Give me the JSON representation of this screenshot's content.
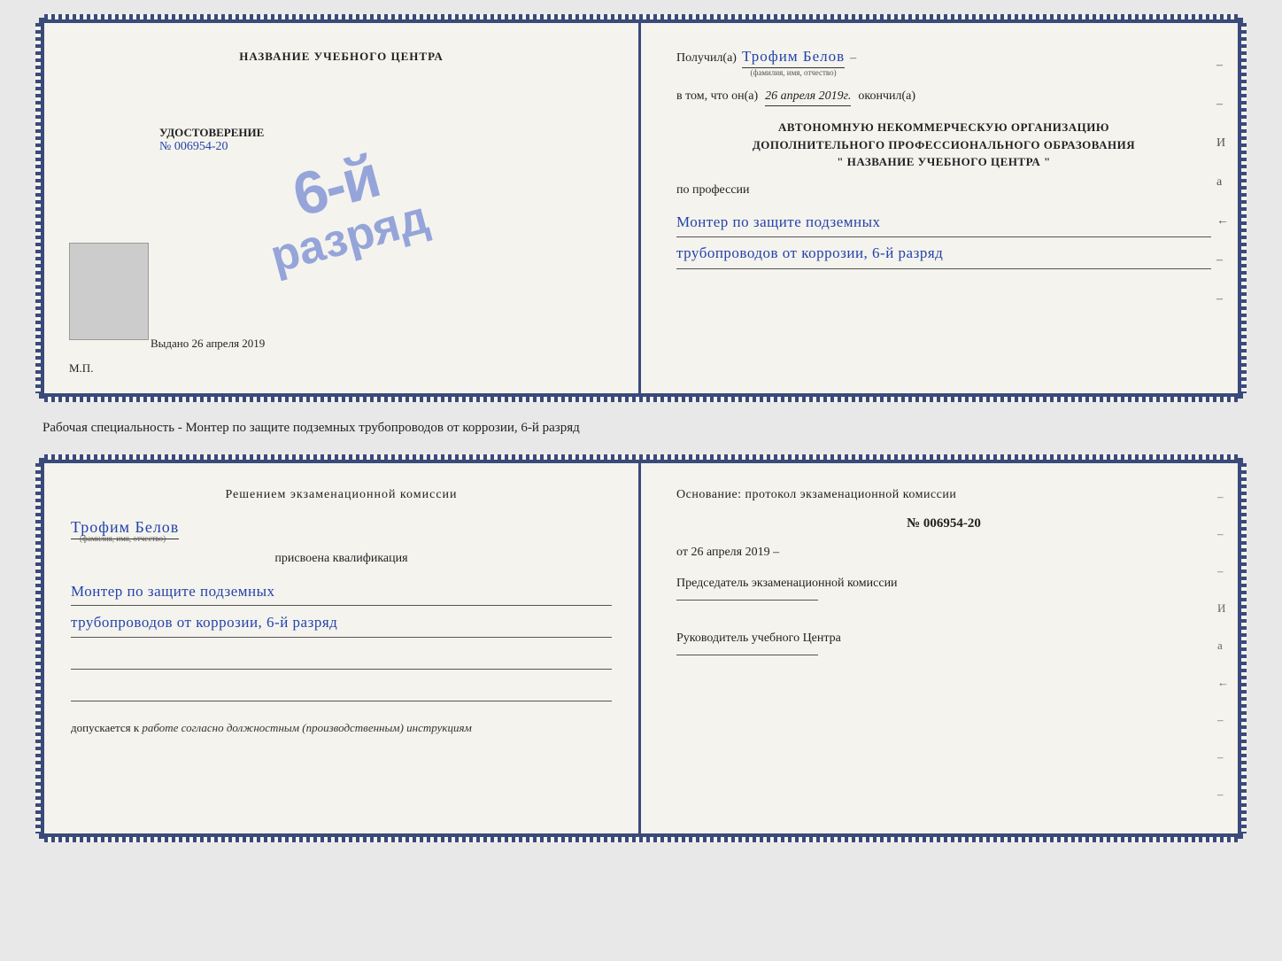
{
  "top_cert": {
    "left": {
      "title": "НАЗВАНИЕ УЧЕБНОГО ЦЕНТРА",
      "stamp_line1": "6-й",
      "stamp_line2": "разряд",
      "udost_label": "УДОСТОВЕРЕНИЕ",
      "number": "№ 006954-20",
      "vydano_label": "Выдано",
      "vydano_date": "26 апреля 2019",
      "mp": "М.П."
    },
    "right": {
      "poluchil_label": "Получил(а)",
      "poluchil_name": "Трофим Белов",
      "fio_label": "(фамилия, имя, отчество)",
      "vtom_label": "в том, что он(а)",
      "date_value": "26 апреля 2019г.",
      "okonchil_label": "окончил(а)",
      "org_line1": "АВТОНОМНУЮ НЕКОММЕРЧЕСКУЮ ОРГАНИЗАЦИЮ",
      "org_line2": "ДОПОЛНИТЕЛЬНОГО ПРОФЕССИОНАЛЬНОГО ОБРАЗОВАНИЯ",
      "org_line3": "\" НАЗВАНИЕ УЧЕБНОГО ЦЕНТРА \"",
      "po_professii": "по профессии",
      "profession_line1": "Монтер по защите подземных",
      "profession_line2": "трубопроводов от коррозии, 6-й разряд",
      "side_dashes": [
        "–",
        "–",
        "И",
        "а",
        "←",
        "–",
        "–",
        "–",
        "–"
      ]
    }
  },
  "middle_text": "Рабочая специальность - Монтер по защите подземных трубопроводов от коррозии, 6-й разряд",
  "bottom_cert": {
    "left": {
      "resheniem_title": "Решением экзаменационной комиссии",
      "name": "Трофим Белов",
      "fio_label": "(фамилия, имя, отчество)",
      "prisvoena": "присвоена квалификация",
      "profession_line1": "Монтер по защите подземных",
      "profession_line2": "трубопроводов от коррозии, 6-й разряд",
      "dopusk_label": "допускается к",
      "dopusk_value": "работе согласно должностным (производственным) инструкциям"
    },
    "right": {
      "osnovanie": "Основание: протокол экзаменационной комиссии",
      "protocol_num": "№ 006954-20",
      "ot_label": "от",
      "ot_date": "26 апреля 2019",
      "predsedatel_label": "Председатель экзаменационной комиссии",
      "rukovoditel_label": "Руководитель учебного Центра",
      "side_dashes": [
        "–",
        "–",
        "–",
        "И",
        "а",
        "←",
        "–",
        "–",
        "–",
        "–"
      ]
    }
  }
}
